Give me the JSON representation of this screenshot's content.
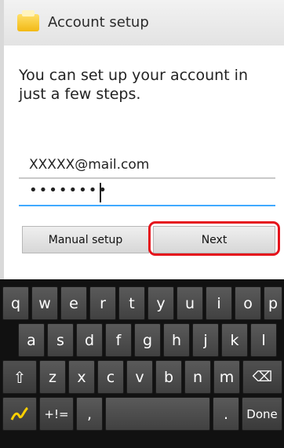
{
  "header": {
    "title": "Account setup"
  },
  "main": {
    "intro": "You can set up your account in just a few steps.",
    "email_value": "XXXXX@mail.com",
    "password_mask": "••••••••",
    "manual_setup_label": "Manual setup",
    "next_label": "Next"
  },
  "keyboard": {
    "row1": [
      "q",
      "w",
      "e",
      "r",
      "t",
      "y",
      "u",
      "i",
      "o",
      "p"
    ],
    "row2": [
      "a",
      "s",
      "d",
      "f",
      "g",
      "h",
      "j",
      "k",
      "l"
    ],
    "row3": [
      "z",
      "x",
      "c",
      "v",
      "b",
      "n",
      "m"
    ],
    "symbols_label": "+!=",
    "comma": ",",
    "period": ".",
    "done_label": "Done"
  },
  "colors": {
    "highlight": "#e5131c",
    "focus_underline": "#40a9ff"
  }
}
